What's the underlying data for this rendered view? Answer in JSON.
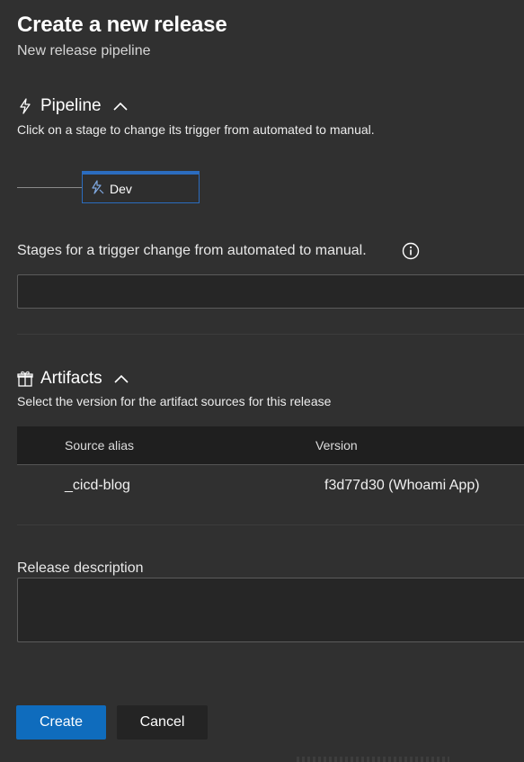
{
  "header": {
    "title": "Create a new release",
    "subtitle": "New release pipeline"
  },
  "pipeline": {
    "heading": "Pipeline",
    "description": "Click on a stage to change its trigger from automated to manual.",
    "stages": [
      {
        "label": "Dev",
        "icon": "stage-trigger-icon"
      }
    ],
    "accent": "#2b6cbf"
  },
  "manual_stages": {
    "label": "Stages for a trigger change from automated to manual.",
    "value": ""
  },
  "artifacts": {
    "heading": "Artifacts",
    "description": "Select the version for the artifact sources for this release",
    "columns": [
      "Source alias",
      "Version"
    ],
    "rows": [
      {
        "source_alias": "_cicd-blog",
        "version": "f3d77d30 (Whoami App)"
      }
    ]
  },
  "release_description": {
    "label": "Release description",
    "value": ""
  },
  "actions": {
    "create_label": "Create",
    "cancel_label": "Cancel",
    "primary_color": "#0f6cbd"
  }
}
